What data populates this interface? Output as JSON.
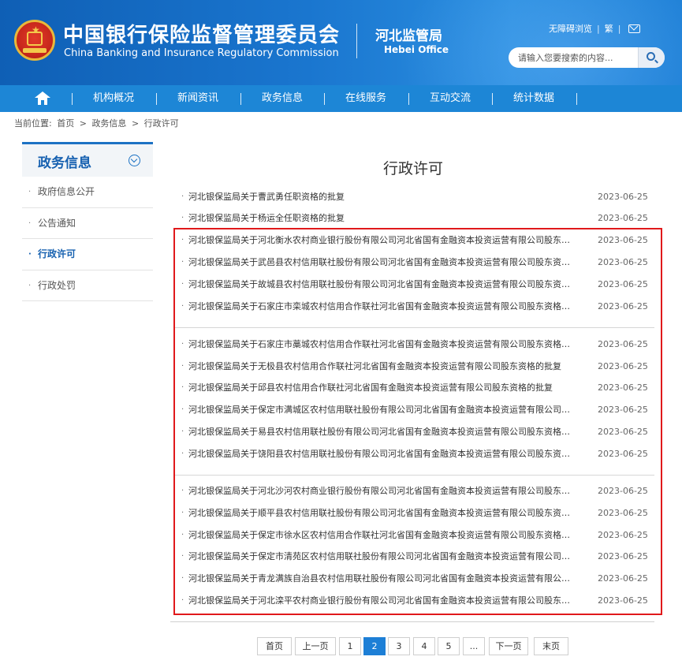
{
  "header": {
    "org_name_cn": "中国银行保险监督管理委员会",
    "org_name_en": "China Banking and Insurance Regulatory Commission",
    "office_cn": "河北监管局",
    "office_en": "Hebei Office",
    "accessibility_link": "无障碍浏览",
    "traditional_link": "繁",
    "search_placeholder": "请输入您要搜索的内容..."
  },
  "nav": {
    "items": [
      "机构概况",
      "新闻资讯",
      "政务信息",
      "在线服务",
      "互动交流",
      "统计数据"
    ]
  },
  "breadcrumb": {
    "prefix": "当前位置:",
    "items": [
      "首页",
      ">",
      "政务信息",
      ">",
      "行政许可"
    ]
  },
  "sidebar": {
    "title": "政务信息",
    "items": [
      {
        "label": "政府信息公开",
        "active": false
      },
      {
        "label": "公告通知",
        "active": false
      },
      {
        "label": "行政许可",
        "active": true
      },
      {
        "label": "行政处罚",
        "active": false
      }
    ]
  },
  "main": {
    "title": "行政许可",
    "rows": [
      {
        "title": "河北银保监局关于曹武勇任职资格的批复",
        "date": "2023-06-25"
      },
      {
        "title": "河北银保监局关于杨运全任职资格的批复",
        "date": "2023-06-25"
      },
      {
        "title": "河北银保监局关于河北衡水农村商业银行股份有限公司河北省国有金融资本投资运营有限公司股东资格...",
        "date": "2023-06-25"
      },
      {
        "title": "河北银保监局关于武邑县农村信用联社股份有限公司河北省国有金融资本投资运营有限公司股东资格的...",
        "date": "2023-06-25"
      },
      {
        "title": "河北银保监局关于故城县农村信用联社股份有限公司河北省国有金融资本投资运营有限公司股东资格的...",
        "date": "2023-06-25"
      },
      {
        "title": "河北银保监局关于石家庄市栾城农村信用合作联社河北省国有金融资本投资运营有限公司股东资格的批复",
        "date": "2023-06-25"
      },
      {
        "title": "河北银保监局关于石家庄市藁城农村信用合作联社河北省国有金融资本投资运营有限公司股东资格的批复",
        "date": "2023-06-25"
      },
      {
        "title": "河北银保监局关于无极县农村信用合作联社河北省国有金融资本投资运营有限公司股东资格的批复",
        "date": "2023-06-25"
      },
      {
        "title": "河北银保监局关于邱县农村信用合作联社河北省国有金融资本投资运营有限公司股东资格的批复",
        "date": "2023-06-25"
      },
      {
        "title": "河北银保监局关于保定市满城区农村信用联社股份有限公司河北省国有金融资本投资运营有限公司股东...",
        "date": "2023-06-25"
      },
      {
        "title": "河北银保监局关于易县农村信用联社股份有限公司河北省国有金融资本投资运营有限公司股东资格的批复",
        "date": "2023-06-25"
      },
      {
        "title": "河北银保监局关于饶阳县农村信用联社股份有限公司河北省国有金融资本投资运营有限公司股东资格的...",
        "date": "2023-06-25"
      },
      {
        "title": "河北银保监局关于河北沙河农村商业银行股份有限公司河北省国有金融资本投资运营有限公司股东资格...",
        "date": "2023-06-25"
      },
      {
        "title": "河北银保监局关于顺平县农村信用联社股份有限公司河北省国有金融资本投资运营有限公司股东资格的...",
        "date": "2023-06-25"
      },
      {
        "title": "河北银保监局关于保定市徐水区农村信用合作联社河北省国有金融资本投资运营有限公司股东资格的批复",
        "date": "2023-06-25"
      },
      {
        "title": "河北银保监局关于保定市清苑区农村信用联社股份有限公司河北省国有金融资本投资运营有限公司股东...",
        "date": "2023-06-25"
      },
      {
        "title": "河北银保监局关于青龙满族自治县农村信用联社股份有限公司河北省国有金融资本投资运营有限公司股...",
        "date": "2023-06-25"
      },
      {
        "title": "河北银保监局关于河北滦平农村商业银行股份有限公司河北省国有金融资本投资运营有限公司股东资格...",
        "date": "2023-06-25"
      }
    ]
  },
  "pagination": {
    "first": "首页",
    "prev": "上一页",
    "pages": [
      "1",
      "2",
      "3",
      "4",
      "5",
      "..."
    ],
    "current": "2",
    "next": "下一页",
    "last": "末页"
  },
  "colors": {
    "brand_blue": "#1d86d6",
    "highlight_red": "#e0191b"
  }
}
